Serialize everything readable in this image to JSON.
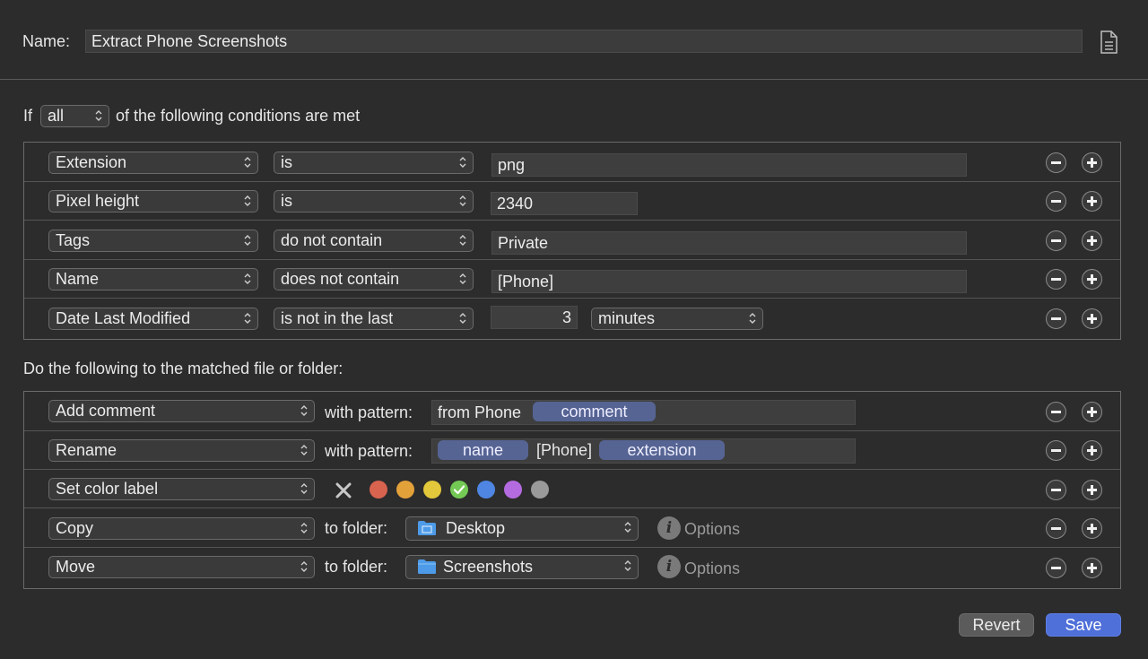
{
  "header": {
    "name_label": "Name:",
    "name_value": "Extract Phone Screenshots",
    "doc_icon": "document-icon"
  },
  "conditions": {
    "prefix": "If",
    "match_select": "all",
    "suffix": "of the following conditions are met",
    "rows": [
      {
        "attribute": "Extension",
        "operator": "is",
        "value": "png"
      },
      {
        "attribute": "Pixel height",
        "operator": "is",
        "value": "2340"
      },
      {
        "attribute": "Tags",
        "operator": "do not contain",
        "value": "Private"
      },
      {
        "attribute": "Name",
        "operator": "does not contain",
        "value": "[Phone]"
      },
      {
        "attribute": "Date Last Modified",
        "operator": "is not in the last",
        "value": "3",
        "unit": "minutes"
      }
    ]
  },
  "actions": {
    "heading": "Do the following to the matched file or folder:",
    "rows": [
      {
        "action": "Add comment",
        "connector": "with pattern:",
        "text": "from Phone",
        "tokens": [
          "comment"
        ]
      },
      {
        "action": "Rename",
        "connector": "with pattern:",
        "tokens": [
          "name",
          "extension"
        ],
        "text": "[Phone]"
      },
      {
        "action": "Set color label",
        "clear_icon": "x-icon",
        "selected_color": "green",
        "colors": [
          "#d8634f",
          "#e3a13a",
          "#e2c83a",
          "#74c955",
          "#4f86e4",
          "#b56be0",
          "#9a9a9a"
        ]
      },
      {
        "action": "Copy",
        "connector": "to folder:",
        "folder": "Desktop",
        "options": "Options"
      },
      {
        "action": "Move",
        "connector": "to folder:",
        "folder": "Screenshots",
        "options": "Options"
      }
    ]
  },
  "footer": {
    "revert": "Revert",
    "save": "Save"
  },
  "colors": {
    "accent": "#4f6fd9",
    "token": "#566493",
    "background": "#2c2c2c"
  }
}
